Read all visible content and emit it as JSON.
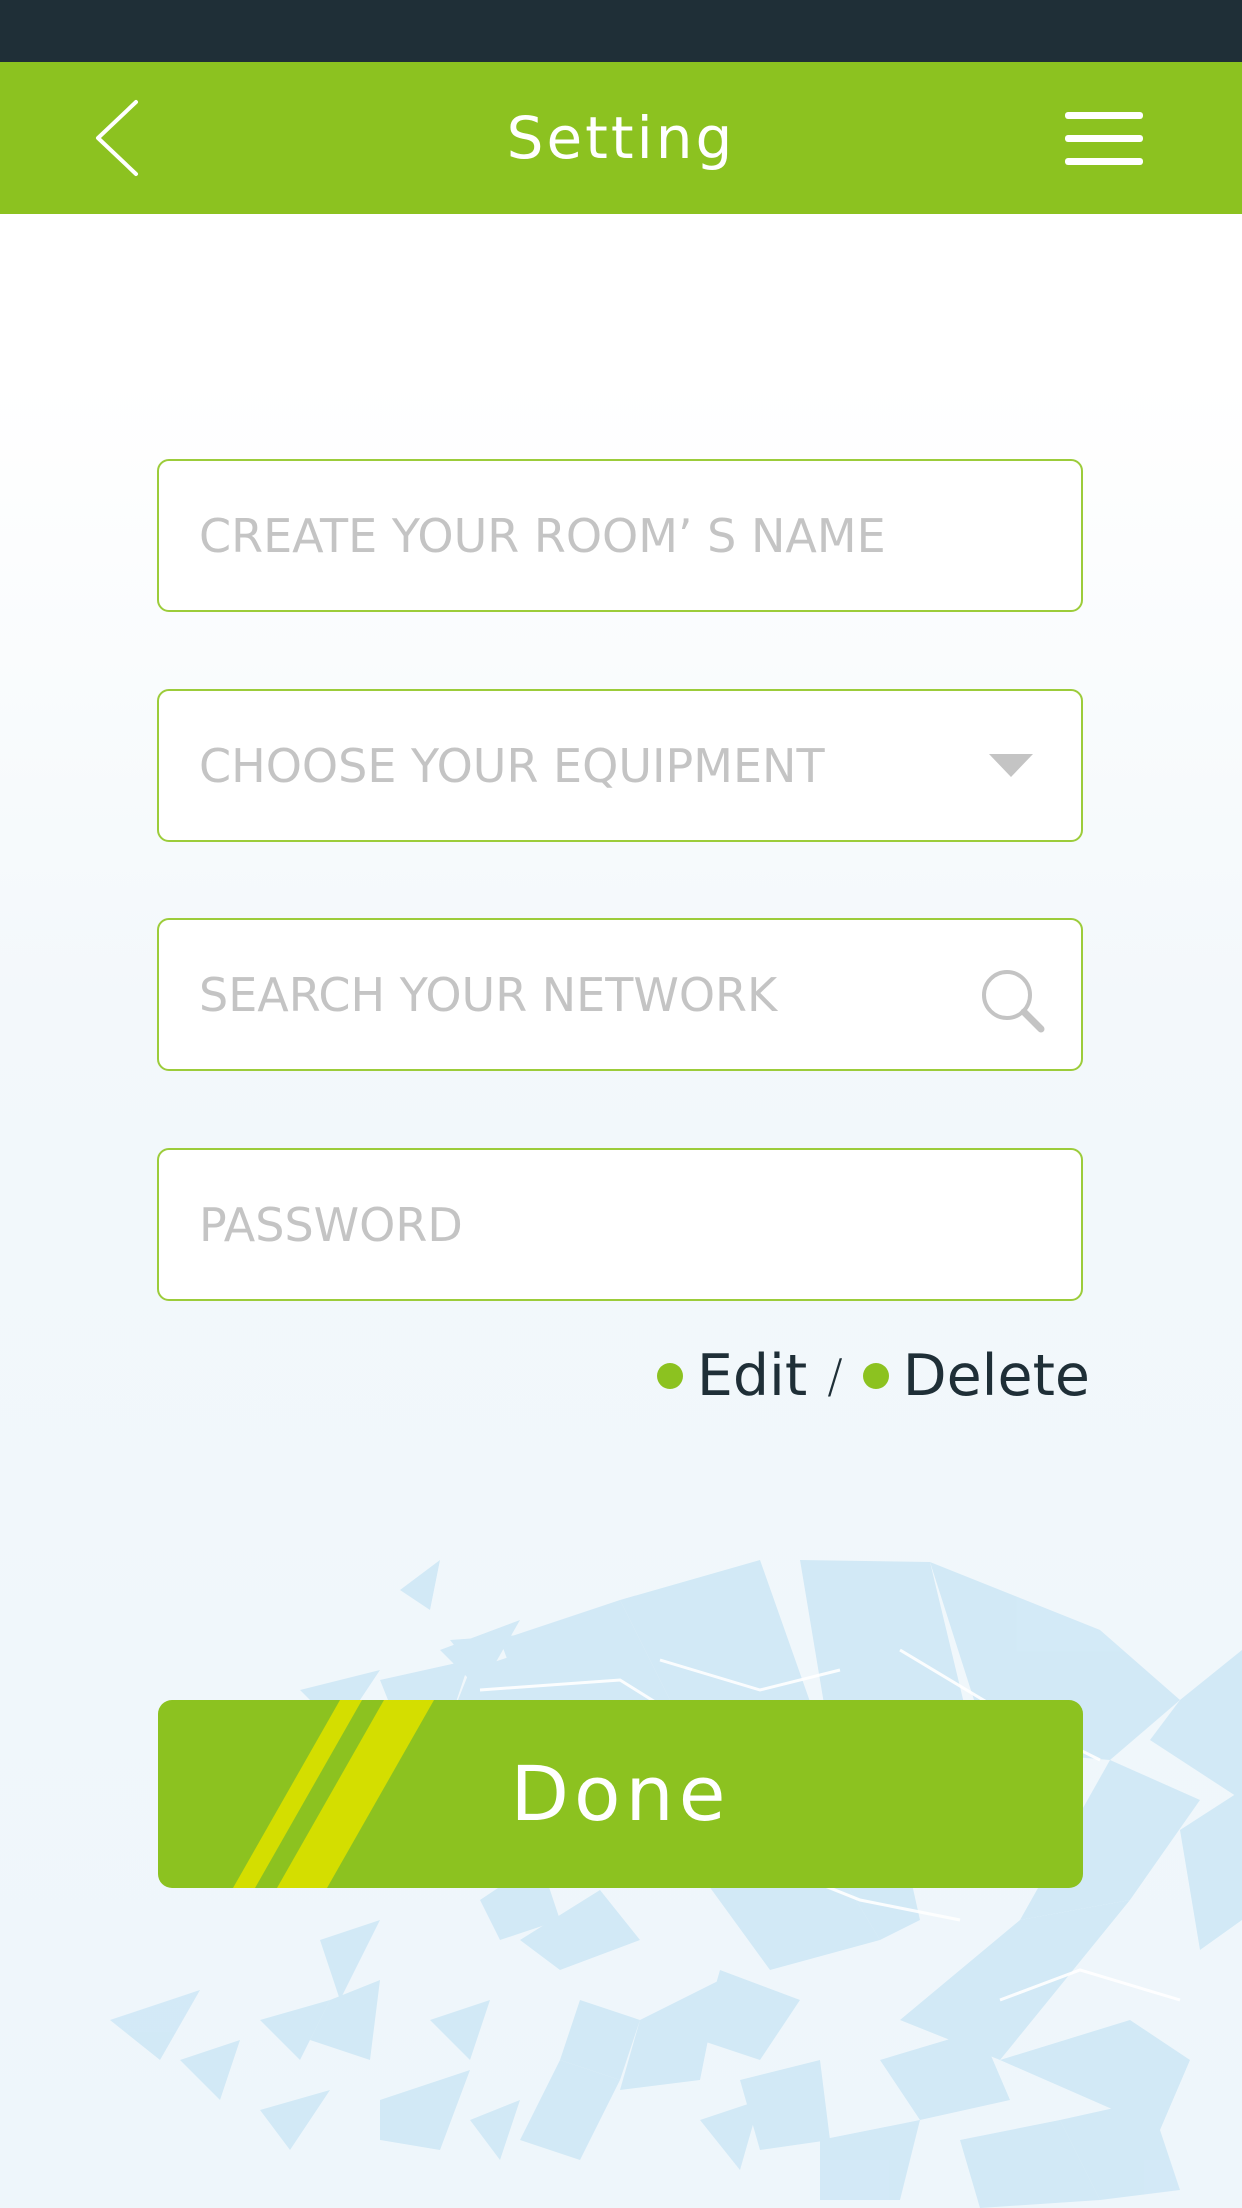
{
  "header": {
    "title": "Setting",
    "back_icon": "chevron-left-icon",
    "menu_icon": "hamburger-menu-icon"
  },
  "form": {
    "room_name": {
      "placeholder": "CREATE YOUR ROOM’ S NAME",
      "value": ""
    },
    "equipment": {
      "placeholder": "CHOOSE YOUR EQUIPMENT",
      "value": "",
      "icon": "dropdown-triangle-icon"
    },
    "network": {
      "placeholder": "SEARCH YOUR NETWORK",
      "value": "",
      "icon": "search-icon"
    },
    "password": {
      "placeholder": "PASSWORD",
      "value": ""
    }
  },
  "actions": {
    "edit_label": "Edit",
    "separator": "/",
    "delete_label": "Delete"
  },
  "done_button": {
    "label": "Done"
  },
  "colors": {
    "status_bar": "#1f2f37",
    "accent_green": "#8cc220",
    "stripe_yellow": "#d4de00",
    "field_border": "#9ccc3a",
    "placeholder": "#c4c4c4",
    "text_dark": "#1f2f37",
    "art_blue": "#cfe8f6"
  }
}
